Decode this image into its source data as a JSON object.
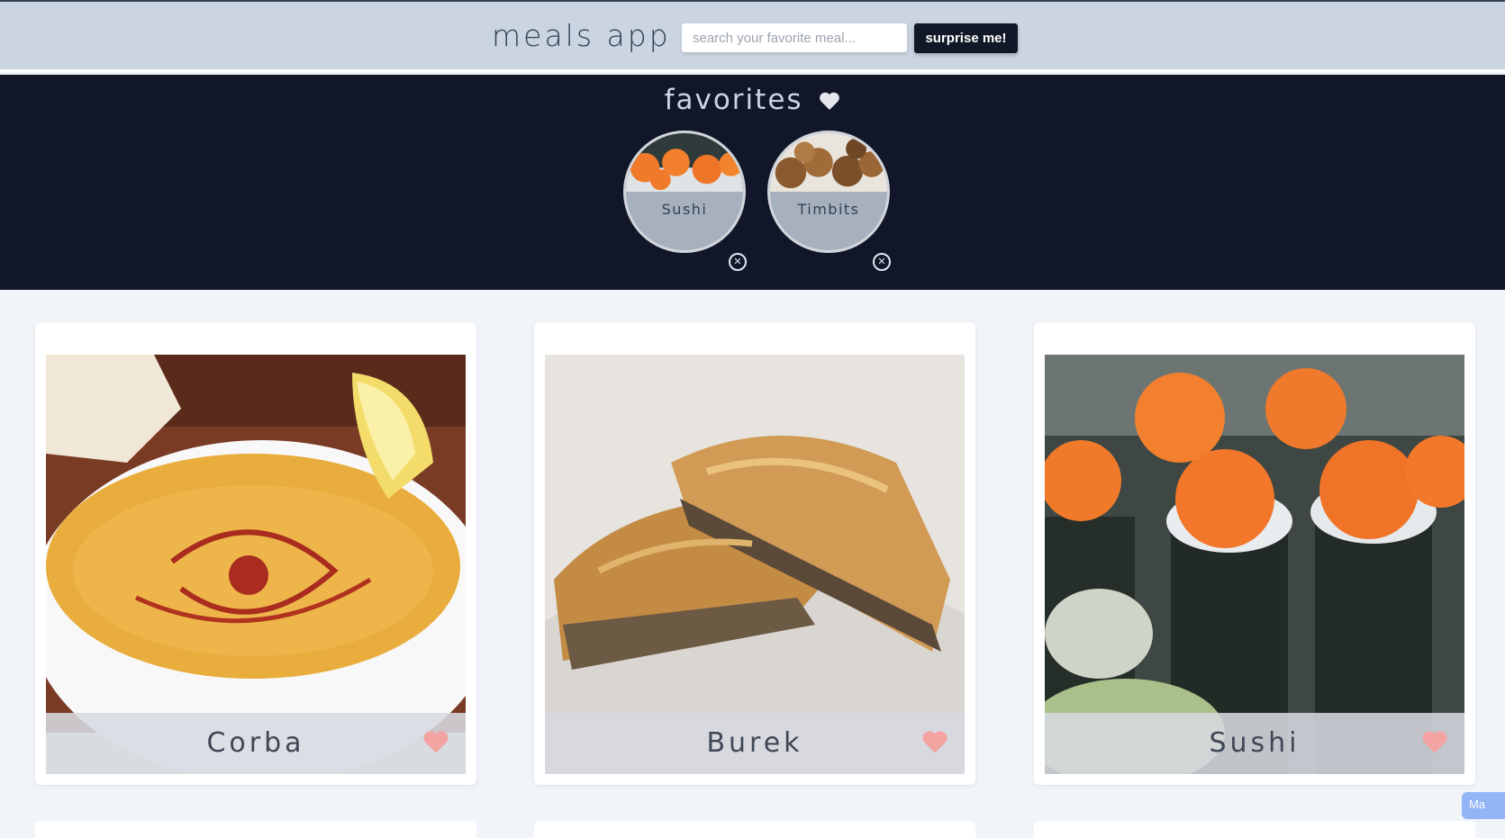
{
  "header": {
    "app_title": "meals app",
    "search_placeholder": "search your favorite meal...",
    "surprise_label": "surprise me!"
  },
  "favorites": {
    "heading": "favorites",
    "items": [
      {
        "name": "Sushi",
        "thumb": "sushi"
      },
      {
        "name": "Timbits",
        "thumb": "timbits"
      }
    ]
  },
  "meals": [
    {
      "name": "Corba",
      "favorite_icon": "heart-icon"
    },
    {
      "name": "Burek",
      "favorite_icon": "heart-icon"
    },
    {
      "name": "Sushi",
      "favorite_icon": "heart-icon"
    }
  ],
  "widget": {
    "label": "Ma"
  },
  "colors": {
    "header_bg": "#cbd5e1",
    "favorites_bg": "#111729",
    "page_bg": "#f1f5f9",
    "heart": "#f4a3a3",
    "button_bg": "#111827"
  }
}
